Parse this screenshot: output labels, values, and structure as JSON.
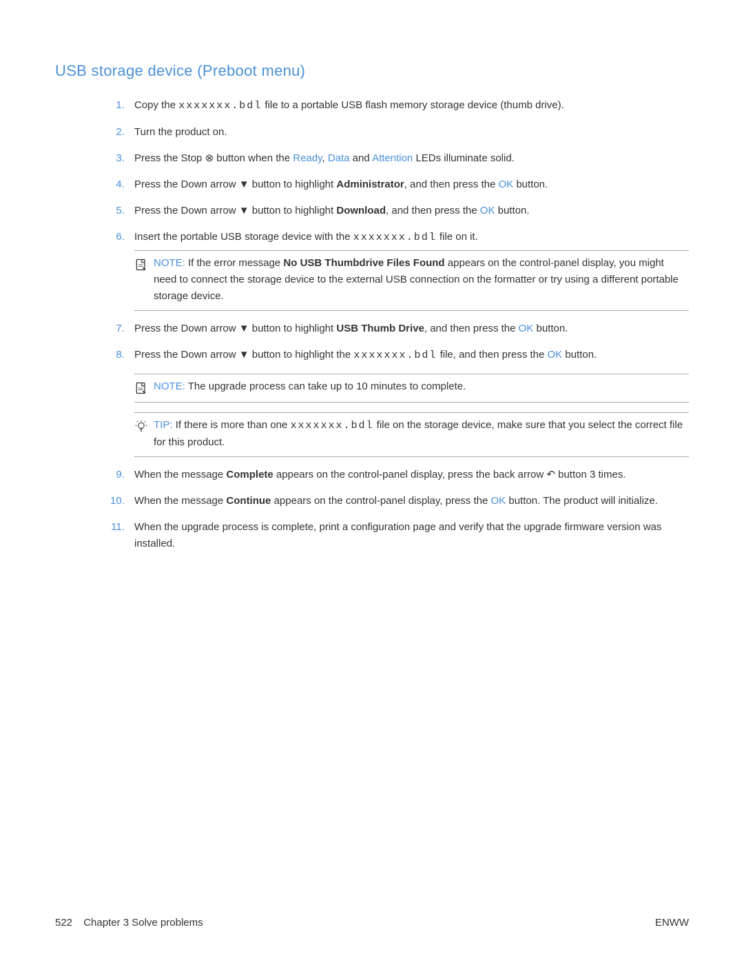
{
  "title": "USB storage device (Preboot menu)",
  "filename": "xxxxxxx.bdl",
  "glyphs": {
    "stop": "⊗",
    "down": "▼",
    "back": "↶"
  },
  "steps": {
    "s1a": "Copy the ",
    "s1b": " file to a portable USB flash memory storage device (thumb drive).",
    "s2": "Turn the product on.",
    "s3a": "Press the Stop ",
    "s3b": " button when the ",
    "s3c": "Ready",
    "s3d": ", ",
    "s3e": "Data",
    "s3f": " and ",
    "s3g": "Attention",
    "s3h": " LEDs illuminate solid.",
    "s4a": "Press the Down arrow ",
    "s4b": " button to highlight ",
    "s4c": "Administrator",
    "s4d": ", and then press the ",
    "s4e": "OK",
    "s4f": " button.",
    "s5a": "Press the Down arrow ",
    "s5b": " button to highlight ",
    "s5c": "Download",
    "s5d": ", and then press the ",
    "s5e": "OK",
    "s5f": " button.",
    "s6a": "Insert the portable USB storage device with the ",
    "s6b": " file on it.",
    "s7a": "Press the Down arrow ",
    "s7b": " button to highlight ",
    "s7c": "USB Thumb Drive",
    "s7d": ", and then press the ",
    "s7e": "OK",
    "s7f": " button.",
    "s8a": "Press the Down arrow ",
    "s8b": " button to highlight the ",
    "s8c": " file, and then press the ",
    "s8d": "OK",
    "s8e": " button.",
    "s9a": "When the message ",
    "s9b": "Complete",
    "s9c": " appears on the control-panel display, press the back arrow ",
    "s9d": " button 3 times.",
    "s10a": "When the message ",
    "s10b": "Continue",
    "s10c": " appears on the control-panel display, press the ",
    "s10d": "OK",
    "s10e": " button. The product will initialize.",
    "s11": "When the upgrade process is complete, print a configuration page and verify that the upgrade firmware version was installed."
  },
  "note1": {
    "label": "NOTE:",
    "a": "If the error message ",
    "b": "No USB Thumbdrive Files Found",
    "c": " appears on the control-panel display, you might need to connect the storage device to the external USB connection on the formatter or try using a different portable storage device."
  },
  "note2": {
    "label": "NOTE:",
    "text": "The upgrade process can take up to 10 minutes to complete."
  },
  "tip1": {
    "label": "TIP:",
    "a": "If there is more than one ",
    "b": " file on the storage device, make sure that you select the correct file for this product."
  },
  "footer": {
    "page": "522",
    "chapter": "Chapter 3   Solve problems",
    "right": "ENWW"
  }
}
